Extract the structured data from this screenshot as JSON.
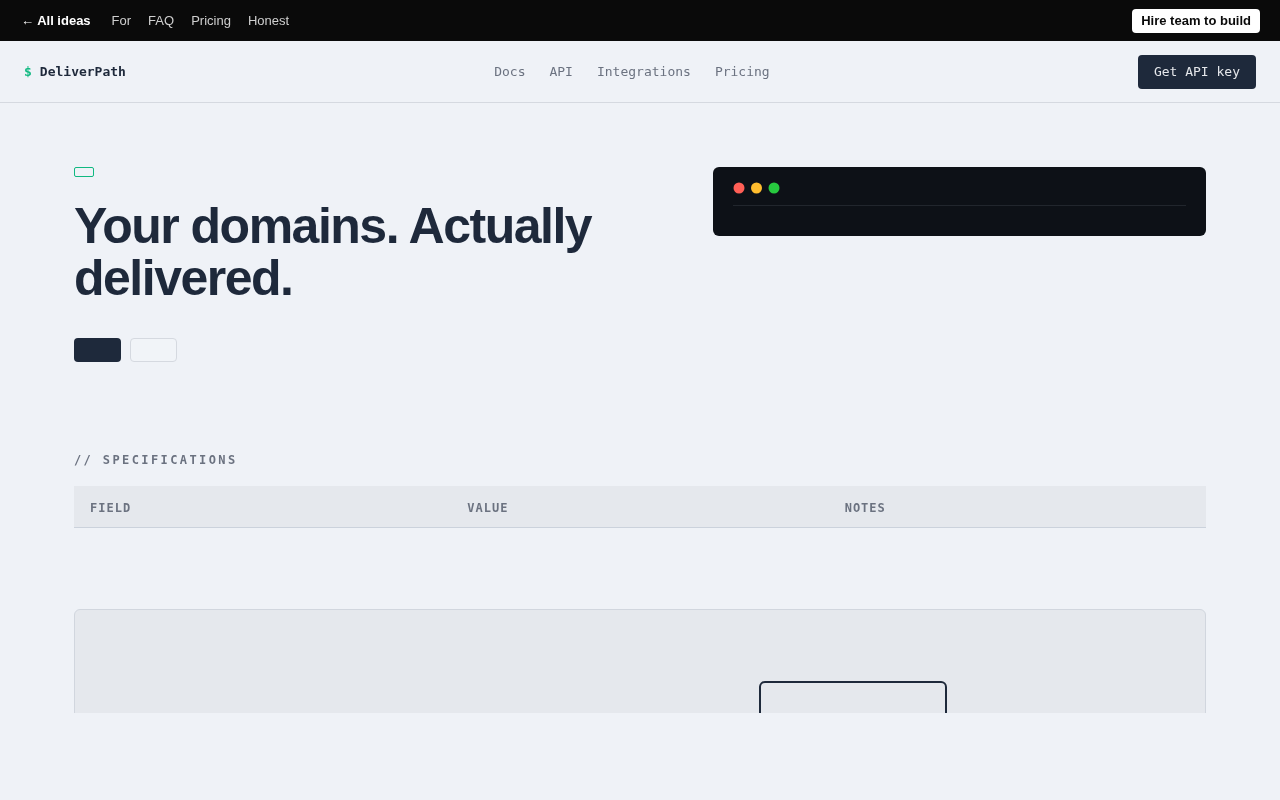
{
  "top_bar": {
    "back_link": "← All ideas",
    "links": [
      "For",
      "FAQ",
      "Pricing",
      "Honest"
    ],
    "cta": "Hire team to build"
  },
  "navbar": {
    "logo_symbol": "$",
    "logo_text": "DeliverPath",
    "links": [
      "Docs",
      "API",
      "Integrations",
      "Pricing"
    ],
    "cta": "Get API key"
  },
  "hero": {
    "headline": "Your domains. Actually delivered."
  },
  "specifications": {
    "heading": "// SPECIFICATIONS",
    "columns": [
      "FIELD",
      "VALUE",
      "NOTES"
    ]
  }
}
